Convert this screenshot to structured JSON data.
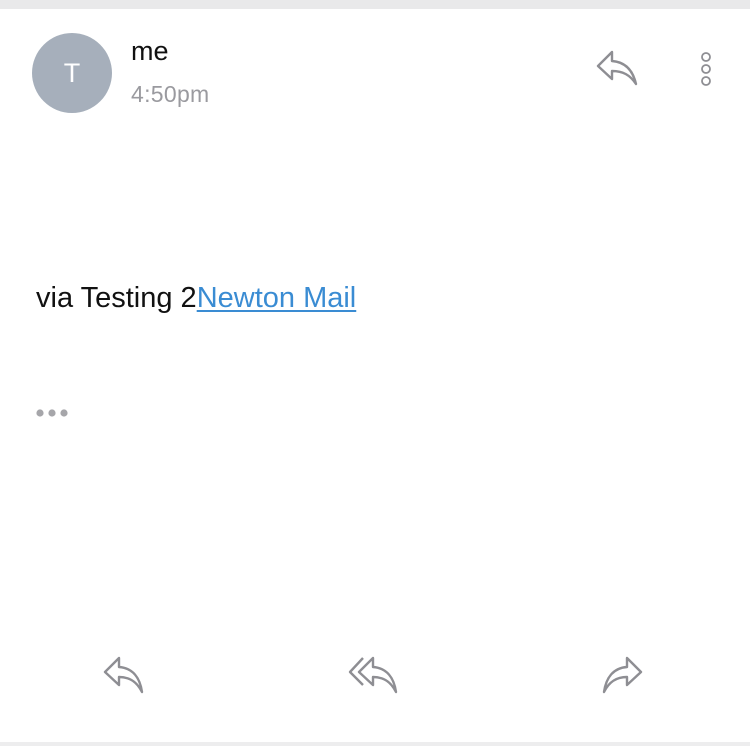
{
  "message": {
    "avatar_initial": "T",
    "sender": "me",
    "time": "4:50pm",
    "body_text": "via Testing 2",
    "body_link": "Newton Mail"
  },
  "icons": {
    "header_reply": "reply-icon",
    "more": "more-vertical-icon",
    "quoted_toggle": "ellipsis-icon",
    "footer_reply": "reply-icon",
    "footer_reply_all": "reply-all-icon",
    "footer_forward": "forward-icon"
  },
  "colors": {
    "avatar": "#a6afbb",
    "link": "#3a8cd3",
    "secondary_text": "#9a9a9f",
    "icon": "#8e8e93"
  }
}
